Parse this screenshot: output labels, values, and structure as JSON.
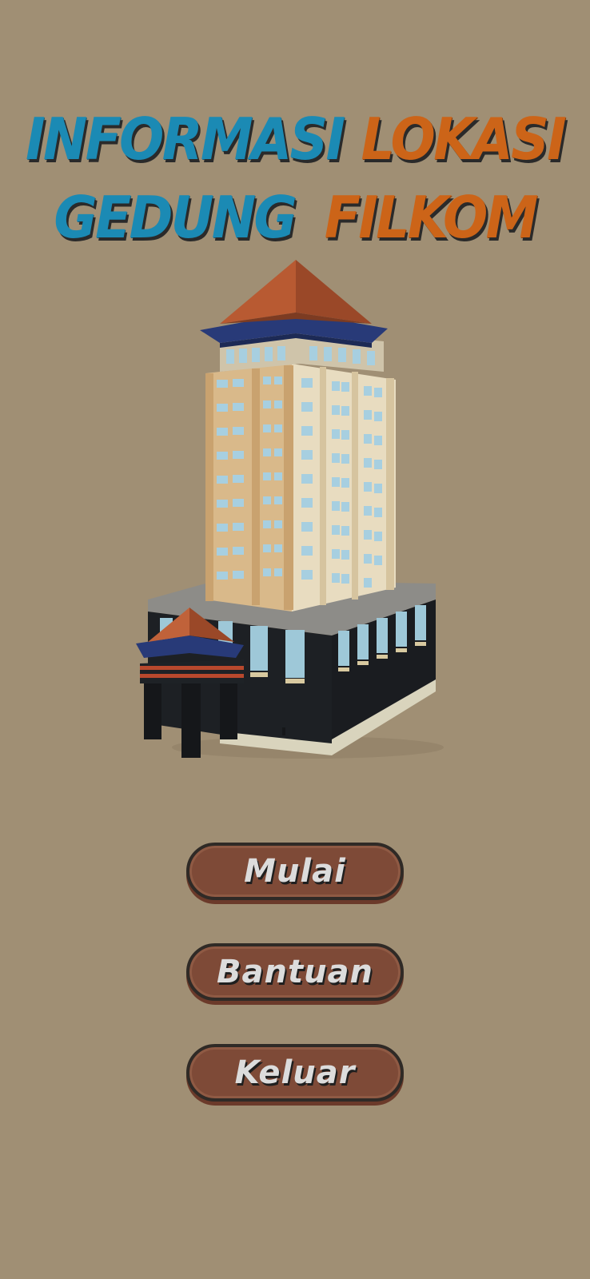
{
  "title": {
    "line1": {
      "word1": "INFORMASI",
      "word2": "LOKASI"
    },
    "line2": {
      "word1": "GEDUNG",
      "word2": "FILKOM"
    }
  },
  "colors": {
    "background": "#a08f74",
    "title_blue": "#1b8ab4",
    "title_orange": "#cc6418",
    "button_fill": "#7e4a37",
    "button_text": "#dcdcdc"
  },
  "menu": {
    "start_label": "Mulai",
    "help_label": "Bantuan",
    "exit_label": "Keluar"
  },
  "illustration": {
    "icon": "filkom-building-3d-model"
  }
}
